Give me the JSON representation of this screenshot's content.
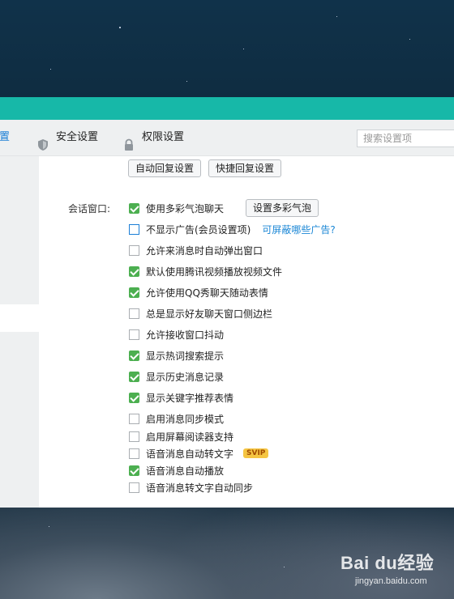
{
  "tabs": [
    {
      "label": "置",
      "icon": "none",
      "active": true
    },
    {
      "label": "安全设置",
      "icon": "shield-icon",
      "active": false
    },
    {
      "label": "权限设置",
      "icon": "lock-icon",
      "active": false
    }
  ],
  "search": {
    "placeholder": "搜索设置项"
  },
  "buttons": {
    "auto_reply": "自动回复设置",
    "quick_reply": "快捷回复设置",
    "bubble": "设置多彩气泡"
  },
  "section": {
    "label": "会话窗口:"
  },
  "options": [
    {
      "label": "使用多彩气泡聊天",
      "checked": true
    },
    {
      "label": "不显示广告(会员设置项)",
      "checked": false,
      "link": "可屏蔽哪些广告?"
    },
    {
      "label": "允许来消息时自动弹出窗口",
      "checked": false
    },
    {
      "label": "默认使用腾讯视频播放视频文件",
      "checked": true
    },
    {
      "label": "允许使用QQ秀聊天随动表情",
      "checked": true
    },
    {
      "label": "总是显示好友聊天窗口侧边栏",
      "checked": false
    },
    {
      "label": "允许接收窗口抖动",
      "checked": false
    },
    {
      "label": "显示热词搜索提示",
      "checked": true
    },
    {
      "label": "显示历史消息记录",
      "checked": true
    },
    {
      "label": "显示关键字推荐表情",
      "checked": true
    },
    {
      "label": "启用消息同步模式",
      "checked": false
    },
    {
      "label": "启用屏幕阅读器支持",
      "checked": false
    },
    {
      "label": "语音消息自动转文字",
      "checked": false,
      "badge": "SVIP"
    },
    {
      "label": "语音消息自动播放",
      "checked": true
    },
    {
      "label": "语音消息转文字自动同步",
      "checked": false
    }
  ],
  "watermark": {
    "brand": "Bai du经验",
    "url": "jingyan.baidu.com"
  },
  "colors": {
    "titlebar": "#17b8a8",
    "checked": "#4caf50",
    "link": "#1b87d6",
    "active_tab": "#1b7fd6"
  }
}
